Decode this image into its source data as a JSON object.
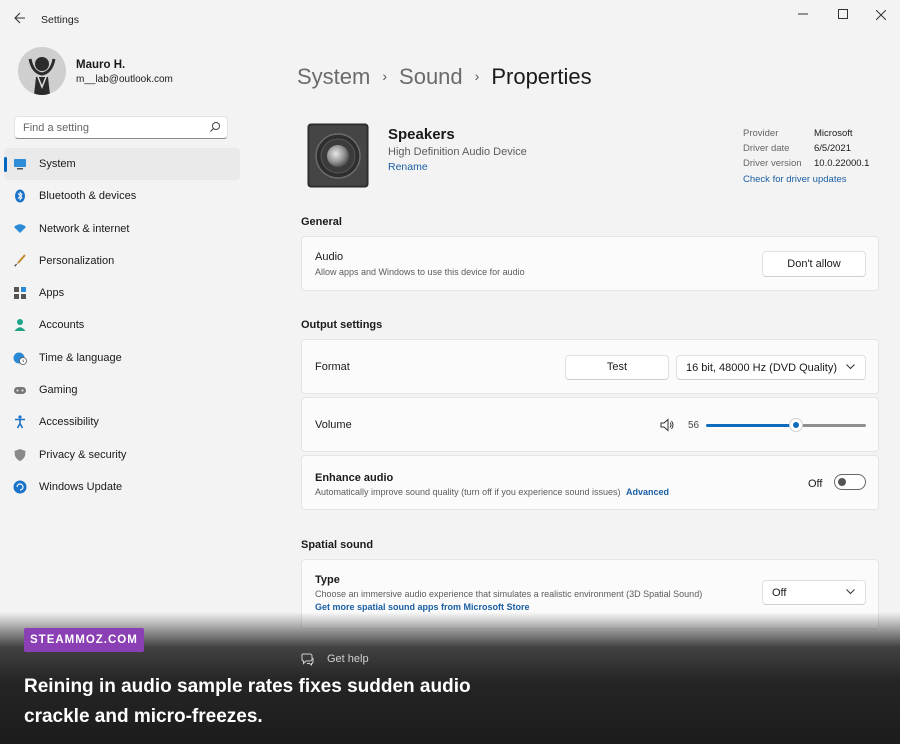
{
  "window": {
    "title": "Settings"
  },
  "profile": {
    "name": "Mauro H.",
    "email": "m__lab@outlook.com"
  },
  "search": {
    "placeholder": "Find a setting"
  },
  "nav": {
    "items": [
      {
        "label": "System",
        "icon": "system-icon",
        "active": true
      },
      {
        "label": "Bluetooth & devices",
        "icon": "bluetooth-icon"
      },
      {
        "label": "Network & internet",
        "icon": "wifi-icon"
      },
      {
        "label": "Personalization",
        "icon": "brush-icon"
      },
      {
        "label": "Apps",
        "icon": "apps-icon"
      },
      {
        "label": "Accounts",
        "icon": "person-icon"
      },
      {
        "label": "Time & language",
        "icon": "globe-clock-icon"
      },
      {
        "label": "Gaming",
        "icon": "gamepad-icon"
      },
      {
        "label": "Accessibility",
        "icon": "accessibility-icon"
      },
      {
        "label": "Privacy & security",
        "icon": "shield-icon"
      },
      {
        "label": "Windows Update",
        "icon": "update-icon"
      }
    ]
  },
  "breadcrumb": {
    "items": [
      "System",
      "Sound",
      "Properties"
    ]
  },
  "device": {
    "name": "Speakers",
    "description": "High Definition Audio Device",
    "rename": "Rename",
    "provider_label": "Provider",
    "provider": "Microsoft",
    "driver_date_label": "Driver date",
    "driver_date": "6/5/2021",
    "driver_version_label": "Driver version",
    "driver_version": "10.0.22000.1",
    "driver_updates_link": "Check for driver updates"
  },
  "general": {
    "heading": "General",
    "audio": {
      "title": "Audio",
      "subtitle": "Allow apps and Windows to use this device for audio",
      "button": "Don't allow"
    }
  },
  "output": {
    "heading": "Output settings",
    "format": {
      "title": "Format",
      "test_button": "Test",
      "value": "16 bit, 48000 Hz (DVD Quality)"
    },
    "volume": {
      "title": "Volume",
      "value": "56",
      "level_percent": 56
    },
    "enhance": {
      "title": "Enhance audio",
      "subtitle": "Automatically improve sound quality (turn off if you experience sound issues)",
      "advanced_link": "Advanced",
      "state": "Off"
    }
  },
  "spatial": {
    "heading": "Spatial sound",
    "type": {
      "title": "Type",
      "subtitle": "Choose an immersive audio experience that simulates a realistic environment (3D Spatial Sound)",
      "store_link": "Get more spatial sound apps from Microsoft Store",
      "value": "Off"
    }
  },
  "help": {
    "label": "Get help"
  },
  "overlay": {
    "brand": "STEAMMOZ.COM",
    "caption": "Reining in audio sample rates fixes sudden audio crackle and micro-freezes."
  },
  "colors": {
    "accent": "#0f6cbd",
    "link": "#1a5fa5",
    "brand_badge": "#8b3fb5"
  }
}
